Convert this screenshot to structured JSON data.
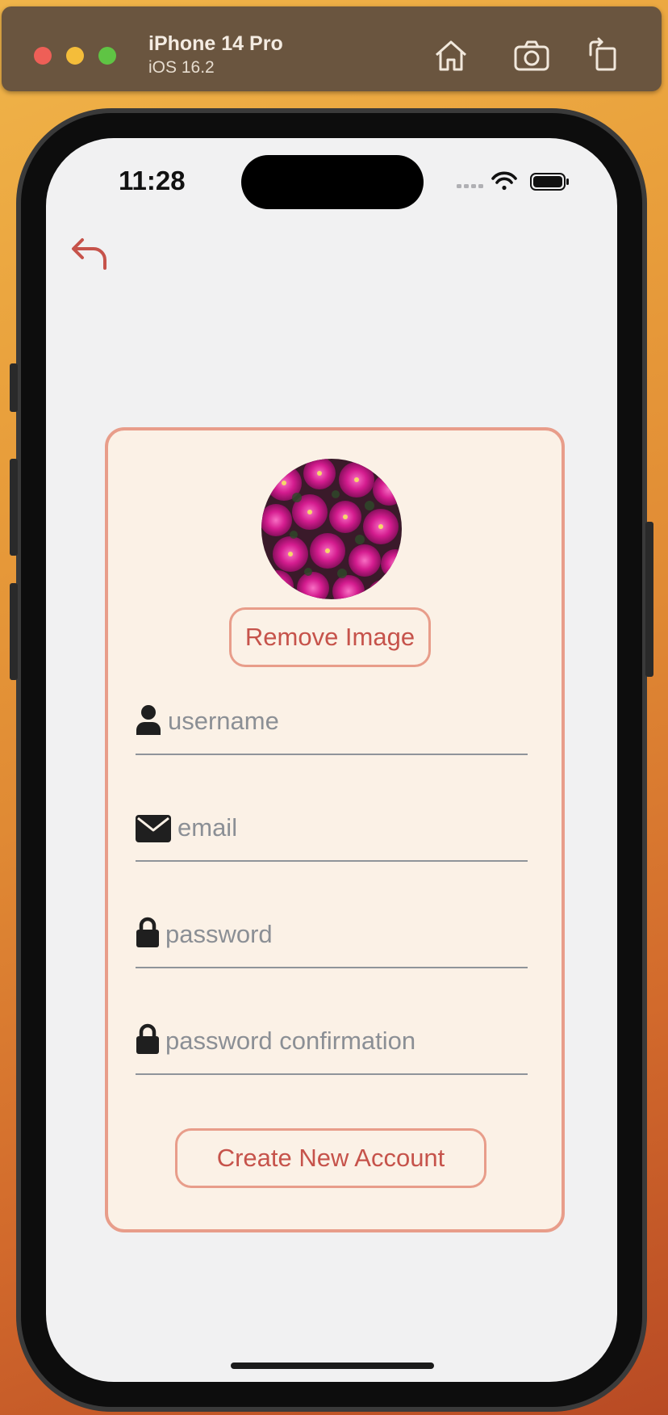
{
  "simulator": {
    "device_name": "iPhone 14 Pro",
    "os_version": "iOS 16.2",
    "toolbar_icons": [
      "home-icon",
      "screenshot-icon",
      "rotate-icon"
    ]
  },
  "status_bar": {
    "time": "11:28",
    "icons": [
      "cellular-icon",
      "wifi-icon",
      "battery-icon"
    ]
  },
  "nav": {
    "back_icon": "back-arrow-icon"
  },
  "form": {
    "remove_image_label": "Remove Image",
    "fields": [
      {
        "icon": "user-icon",
        "placeholder": "username",
        "value": ""
      },
      {
        "icon": "envelope-icon",
        "placeholder": "email",
        "value": ""
      },
      {
        "icon": "lock-icon",
        "placeholder": "password",
        "value": ""
      },
      {
        "icon": "lock-icon",
        "placeholder": "password confirmation",
        "value": ""
      }
    ],
    "submit_label": "Create New Account"
  },
  "colors": {
    "accent": "#c6534b",
    "card_border": "#e89d8a",
    "card_background": "#fbf1e6",
    "screen_background": "#f1f1f2",
    "placeholder": "#8b8f95"
  }
}
